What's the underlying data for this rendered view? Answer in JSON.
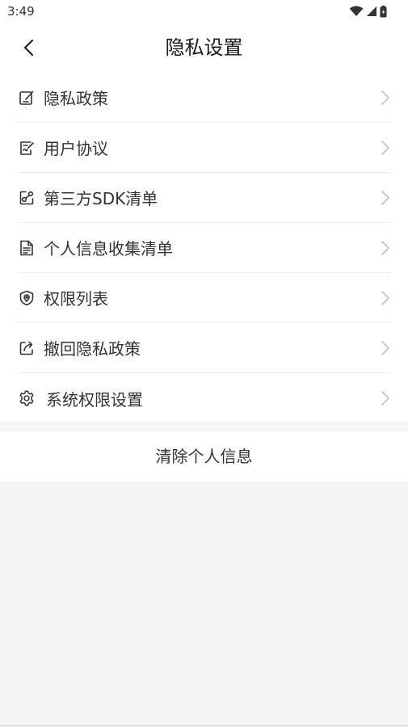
{
  "status_bar": {
    "time": "3:49",
    "icons": [
      "wifi-icon",
      "signal-icon",
      "battery-icon"
    ]
  },
  "header": {
    "title": "隐私设置",
    "back_icon": "back-arrow-icon"
  },
  "menu": [
    {
      "label": "隐私政策",
      "icon": "edit-note-icon"
    },
    {
      "label": "用户协议",
      "icon": "signed-document-icon"
    },
    {
      "label": "第三方SDK清单",
      "icon": "share-link-icon"
    },
    {
      "label": "个人信息收集清单",
      "icon": "document-list-icon"
    },
    {
      "label": "权限列表",
      "icon": "shield-location-icon"
    },
    {
      "label": "撤回隐私政策",
      "icon": "external-share-icon"
    },
    {
      "label": "系统权限设置",
      "icon": "gear-icon"
    }
  ],
  "clear_button": {
    "label": "清除个人信息"
  },
  "colors": {
    "background": "#f4f4f4",
    "surface": "#ffffff",
    "text": "#333333",
    "chevron": "#c4c4c4"
  }
}
